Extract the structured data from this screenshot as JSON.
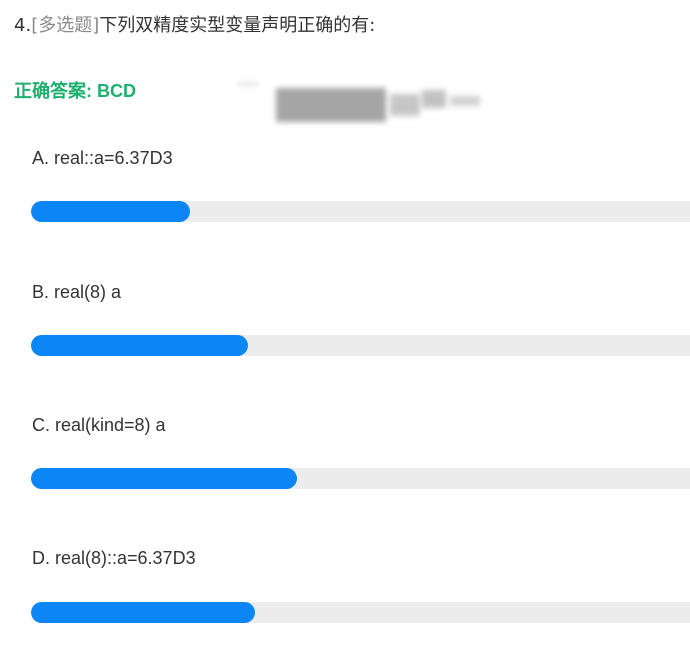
{
  "question": {
    "number": "4.",
    "type_label": "[多选题]",
    "text": "下列双精度实型变量声明正确的有:"
  },
  "answer": {
    "label": "正确答案: BCD"
  },
  "options": [
    {
      "label": "A. real::a=6.37D3",
      "fill_fraction": 0.242
    },
    {
      "label": "B. real(8) a",
      "fill_fraction": 0.329
    },
    {
      "label": "C. real(kind=8) a",
      "fill_fraction": 0.403
    },
    {
      "label": "D. real(8)::a=6.37D3",
      "fill_fraction": 0.34
    }
  ],
  "colors": {
    "accent_green": "#1fb06f",
    "progress_fill": "#0d86f5",
    "progress_track": "#ececec",
    "type_gray": "#8a8a8a"
  }
}
